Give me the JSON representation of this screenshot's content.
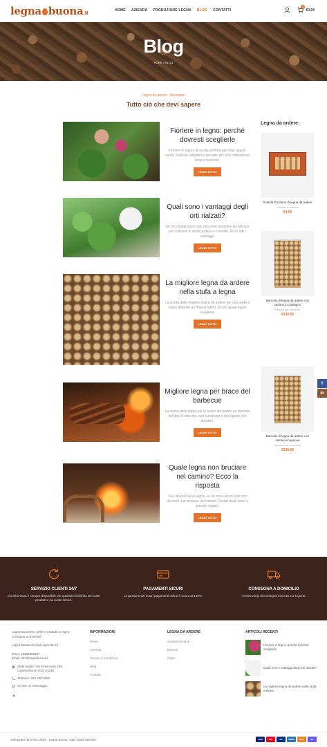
{
  "header": {
    "logo_main": "legna",
    "logo_end": "buona",
    "logo_suffix": ".it",
    "nav": [
      "HOME",
      "AZIENDA",
      "PRODUZIONE LEGNA",
      "BLOG",
      "CONTATTI"
    ],
    "active_nav": "BLOG",
    "cart_count": "0",
    "cart_total": "€0,00"
  },
  "hero": {
    "title": "Blog",
    "breadcrumb": "HOME > BLOG"
  },
  "section": {
    "subtitle": "Legna da ardere - Accessori",
    "title": "Tutto ciò che devi sapere"
  },
  "posts": [
    {
      "title": "Fioriere in legno: perché dovresti sceglierle",
      "excerpt": "Fioriere in legno: la scelta perfetta per il tuo spazio verde. Naturali, eleganti e pensate per una coltivazione sana e durevole.",
      "button": "LEGGI TUTTO"
    },
    {
      "title": "Quali sono i vantaggi degli orti rialzati?",
      "excerpt": "Gli orti rialzati sono una soluzione semplice ed efficace per coltivare in modo pratico e comodo. Ecco tutti i vantaggi.",
      "button": "LEGGI TUTTO"
    },
    {
      "title": "La migliore legna da ardere nella stufa a legna",
      "excerpt": "La scelta della migliore legna da ardere per una stufa a legna dipende da diversi fattori. Scopri quale legna scegliere.",
      "button": "LEGGI TUTTO"
    },
    {
      "title": "Migliore legna per brace del barbecue",
      "excerpt": "La scelta della legna per la brace del barbecue dipende dal tipo di cibo che vuoi cuocinare e dal sapore che desideri.",
      "button": "LEGGI TUTTO"
    },
    {
      "title": "Quale legna non bruciare nel camino? Ecco la risposta",
      "excerpt": "Tra i diversi tipi di legna, ce ne sono alcuni che non dovresti mai bruciare nel camino. Scopri quali sono e perché evitarli.",
      "button": "LEGGI TUTTO"
    }
  ],
  "sidebar": {
    "title": "Legna da ardere:",
    "products": [
      {
        "name": "Scatola Fai da te di legna da ardere",
        "category": "Scatole in cartone",
        "price": "€4,00"
      },
      {
        "name": "Bancale di legna da ardere con camino in castagno",
        "category": "Bancali per caminetti",
        "price": "€330,00"
      },
      {
        "name": "Bancale di legna da ardere con camino in quercia",
        "category": "Bancali per caminetti",
        "price": "€330,00"
      }
    ]
  },
  "social": [
    "f",
    "in"
  ],
  "services": [
    {
      "title": "SERVIZIO CLIENTI 24/7",
      "text": "Il nostro team è sempre disponibile per qualsiasi richiesta sui nostri prodotti e sui nostri servizi."
    },
    {
      "title": "PAGAMENTI SICURI",
      "text": "La gestione dei nostri pagamenti online è sicura al 100%."
    },
    {
      "title": "CONSEGNA A DOMICILIO",
      "text": "I nostri tempi di consegna sono da 3 a 5 giorni."
    }
  ],
  "footer": {
    "about": "Legna da ardere, pellet e prodotti in legno, consegna a domicilio.",
    "company": "Legna Buona Società Agricola Srl",
    "vat": "P.IVA: 10294850637",
    "email_office": "Email: info@legnabuona.it",
    "address": "Sede legale: Via Provinciale 148, Castelvolturno (CE) 81030",
    "phone": "Telefono: 333 000 0000",
    "contact_link": "Scrivici un messaggio",
    "cols": [
      {
        "title": "INFORMAZIONI",
        "links": [
          "Home",
          "Azienda",
          "Termini e Condizioni",
          "Blog",
          "Contatti"
        ]
      },
      {
        "title": "LEGNA DA ARDERE",
        "links": [
          "Scatola fai da te",
          "Bancali",
          "Pellet"
        ]
      }
    ],
    "recent_title": "ARTICOLI RECENTI",
    "recent": [
      "Fioriere in legno: perché dovresti sceglierle",
      "Quali sono i vantaggi degli orti rialzati?",
      "La migliore legna da ardere nella stufa a legna"
    ],
    "copyright": "Sviluppato da XTEC 2023 - Legna Buona. Tutti i diritti riservati",
    "payments": [
      "VISA",
      "MC",
      "PP",
      "AMEX",
      "DISC",
      "ST"
    ]
  },
  "colors": {
    "accent": "#e3722c",
    "brown": "#3c241c",
    "title_brown": "#7a4a2c"
  }
}
